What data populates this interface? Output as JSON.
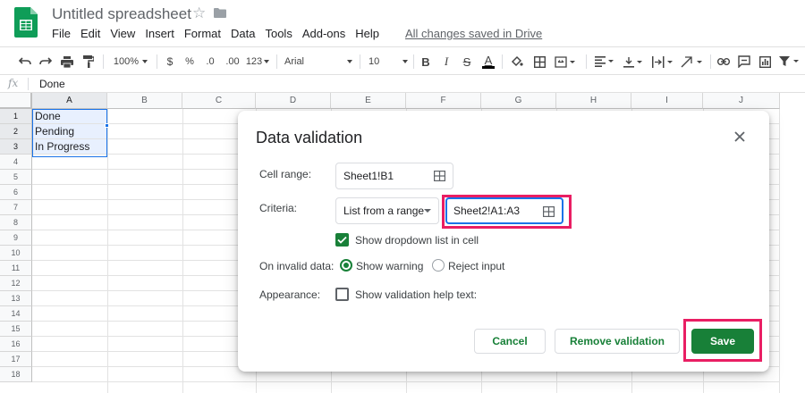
{
  "app": {
    "title": "Untitled spreadsheet",
    "menu": [
      "File",
      "Edit",
      "View",
      "Insert",
      "Format",
      "Data",
      "Tools",
      "Add-ons",
      "Help"
    ],
    "save_status": "All changes saved in Drive"
  },
  "toolbar": {
    "zoom": "100%",
    "currency": "$",
    "percent": "%",
    "decimal_decrease": ".0",
    "decimal_increase": ".00",
    "number_format": "123",
    "font": "Arial",
    "font_size": "10",
    "bold": "B",
    "italic": "I",
    "strike": "S",
    "text_color": "A"
  },
  "formula_bar": {
    "fx": "fx",
    "value": "Done"
  },
  "grid": {
    "columns": [
      "A",
      "B",
      "C",
      "D",
      "E",
      "F",
      "G",
      "H",
      "I",
      "J"
    ],
    "rows": [
      "1",
      "2",
      "3",
      "4",
      "5",
      "6",
      "7",
      "8",
      "9",
      "10",
      "11",
      "12",
      "13",
      "14",
      "15",
      "16",
      "17",
      "18"
    ],
    "cells": {
      "A1": "Done",
      "A2": "Pending",
      "A3": "In Progress"
    }
  },
  "dialog": {
    "title": "Data validation",
    "cell_range_label": "Cell range:",
    "cell_range_value": "Sheet1!B1",
    "criteria_label": "Criteria:",
    "criteria_type": "List from a range",
    "criteria_range": "Sheet2!A1:A3",
    "show_dropdown_label": "Show dropdown list in cell",
    "show_dropdown_checked": true,
    "invalid_label": "On invalid data:",
    "show_warning": "Show warning",
    "reject_input": "Reject input",
    "appearance_label": "Appearance:",
    "help_text_label": "Show validation help text:",
    "help_text_checked": false,
    "cancel": "Cancel",
    "remove": "Remove validation",
    "save": "Save"
  },
  "colors": {
    "brand_green": "#188038",
    "highlight": "#e91e63",
    "selection_blue": "#1a73e8"
  }
}
